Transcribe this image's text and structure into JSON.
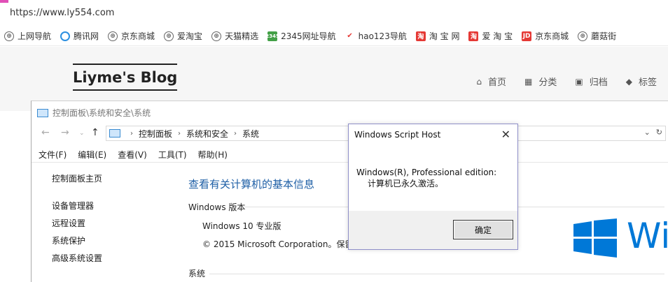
{
  "browser": {
    "url": "https://www.ly554.com",
    "bookmarks": [
      {
        "label": "上网导航",
        "icon": "globe-icon"
      },
      {
        "label": "腾讯网",
        "icon": "tencent-icon"
      },
      {
        "label": "京东商城",
        "icon": "globe-icon"
      },
      {
        "label": "爱淘宝",
        "icon": "globe-icon"
      },
      {
        "label": "天猫精选",
        "icon": "globe-icon"
      },
      {
        "label": "2345网址导航",
        "icon": "2345-icon"
      },
      {
        "label": "hao123导航",
        "icon": "hao123-icon"
      },
      {
        "label": "淘 宝 网",
        "icon": "taobao-icon"
      },
      {
        "label": "爱 淘 宝",
        "icon": "taobao-icon"
      },
      {
        "label": "京东商城",
        "icon": "jd-icon"
      },
      {
        "label": "蘑菇街",
        "icon": "globe-icon"
      }
    ]
  },
  "blog": {
    "logo": "Liyme's Blog",
    "nav": [
      {
        "label": "首页",
        "icon": "home-icon"
      },
      {
        "label": "分类",
        "icon": "grid-icon"
      },
      {
        "label": "归档",
        "icon": "archive-icon"
      },
      {
        "label": "标签",
        "icon": "tag-icon"
      }
    ]
  },
  "control_panel": {
    "title": "控制面板\\系统和安全\\系统",
    "breadcrumb": [
      "控制面板",
      "系统和安全",
      "系统"
    ],
    "menu": [
      "文件(F)",
      "编辑(E)",
      "查看(V)",
      "工具(T)",
      "帮助(H)"
    ],
    "sidebar_home": "控制面板主页",
    "sidebar_links": [
      "设备管理器",
      "远程设置",
      "系统保护",
      "高级系统设置"
    ],
    "heading": "查看有关计算机的基本信息",
    "section_windows": "Windows 版本",
    "edition": "Windows 10 专业版",
    "copyright": "© 2015 Microsoft Corporation。保留",
    "section_system": "系统",
    "brand_text": "Wi"
  },
  "dialog": {
    "title": "Windows Script Host",
    "line1": "Windows(R), Professional edition:",
    "line2": "计算机已永久激活。",
    "ok_label": "确定"
  },
  "colors": {
    "windows_blue": "#0078d7",
    "heading_blue": "#1e5fa6",
    "accent_pink": "#e14fb7"
  }
}
